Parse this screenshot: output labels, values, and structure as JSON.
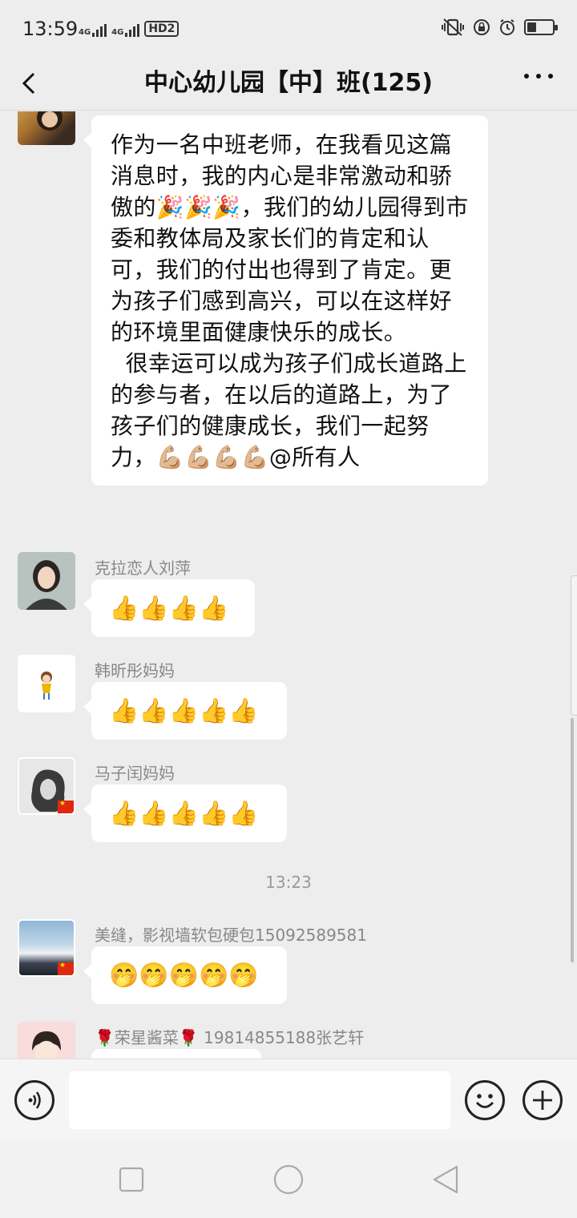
{
  "status": {
    "time": "13:59",
    "net1": "4G",
    "net2": "4G",
    "hd": "HD2"
  },
  "header": {
    "title": "中心幼儿园【中】班(125)"
  },
  "messages": {
    "m1": {
      "p1": "作为一名中班老师，在我看见这篇消息时，我的内心是非常激动和骄傲的🎉🎉🎉，我们的幼儿园得到市委和教体局及家长们的肯定和认可，我们的付出也得到了肯定。更为孩子们感到高兴，可以在这样好的环境里面健康快乐的成长。",
      "p2": "  很幸运可以成为孩子们成长道路上的参与者，在以后的道路上，为了孩子们的健康成长，我们一起努力，💪🏼💪🏼💪🏼💪🏼@所有人"
    },
    "m2": {
      "sender": "克拉恋人刘萍",
      "text": "👍👍👍👍"
    },
    "m3": {
      "sender": "韩昕彤妈妈",
      "text": "👍👍👍👍👍"
    },
    "m4": {
      "sender": "马子闰妈妈",
      "text": "👍👍👍👍👍"
    },
    "time_sep": "13:23",
    "m5": {
      "sender": "美缝，影视墙软包硬包15092589581",
      "text": "🤭🤭🤭🤭🤭"
    },
    "m6": {
      "sender": "🌹荣星酱菜🌹 19814855188张艺轩"
    }
  },
  "input": {
    "placeholder": ""
  },
  "icons": {
    "back": "chevron-left-icon",
    "more": "more-dots-icon",
    "voice": "voice-icon",
    "emoji": "emoji-icon",
    "add": "plus-icon"
  }
}
